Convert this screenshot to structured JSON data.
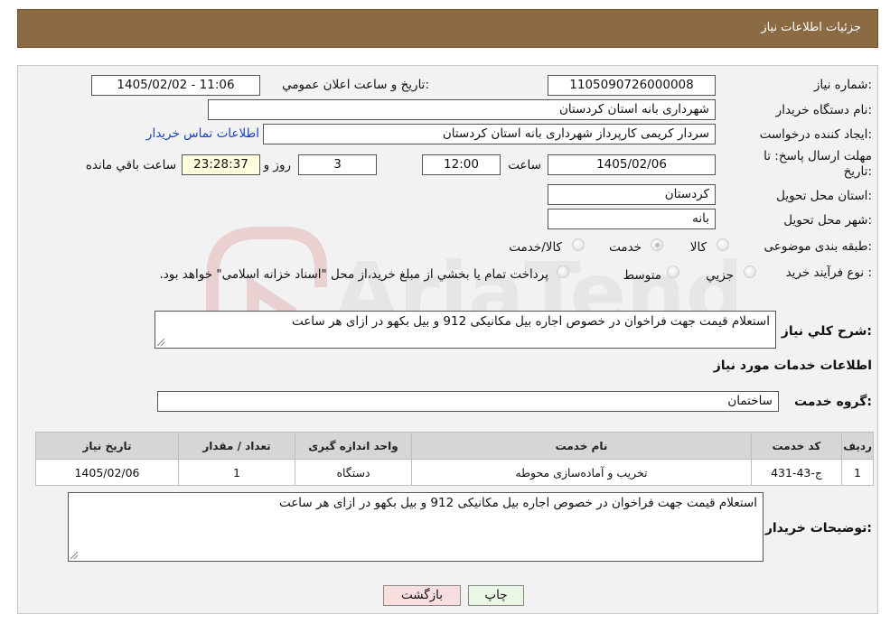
{
  "header": {
    "title": "جزئیات اطلاعات نیاز"
  },
  "labels": {
    "need_number": "شماره نیاز:",
    "announce_datetime": "تاریخ و ساعت اعلان عمومي:",
    "buyer_org": "نام دستگاه خريدار:",
    "requester": "ايجاد کننده درخواست:",
    "deadline_line1": "مهلت ارسال پاسخ: تا",
    "deadline_line2": "تاريخ:",
    "time_word": "ساعت",
    "days_word": "روز و",
    "remaining": "ساعت باقي مانده",
    "province": "استان محل تحويل:",
    "city": "شهر محل تحويل:",
    "category": "طبقه بندی موضوعی:",
    "purchase_type": "نوع فرآيند خريد :",
    "description": "شرح کلي نياز:",
    "services_info": "اطلاعات خدمات مورد نياز",
    "service_group": "گروه خدمت:",
    "buyer_notes": "توضيحات خريدار:"
  },
  "values": {
    "need_number": "1105090726000008",
    "announce_datetime": "1405/02/02 - 11:06",
    "buyer_org": "شهرداری بانه استان کردستان",
    "requester": "سردار کریمی کارپرداز شهرداری بانه استان کردستان",
    "contact_link": "اطلاعات تماس خريدار",
    "deadline_date": "1405/02/06",
    "deadline_time": "12:00",
    "days": "3",
    "remaining_time": "23:28:37",
    "province": "کردستان",
    "city": "بانه",
    "description": "استعلام قیمت جهت فراخوان در خصوص اجاره بیل مکانیکی 912 و بیل بکهو در ازای هر ساعت",
    "service_group": "ساختمان",
    "buyer_notes": "استعلام قیمت جهت فراخوان در خصوص اجاره بیل مکانیکی 912 و بیل بکهو در ازای هر ساعت"
  },
  "category_options": [
    {
      "label": "کالا",
      "selected": false
    },
    {
      "label": "خدمت",
      "selected": true
    },
    {
      "label": "کالا/خدمت",
      "selected": false
    }
  ],
  "purchase_options": [
    {
      "label": "جزيي",
      "selected": false
    },
    {
      "label": "متوسط",
      "selected": false
    }
  ],
  "purchase_note": "پرداخت تمام يا بخشي از مبلغ خريد،از محل \"اسناد خزانه اسلامی\" خواهد بود.",
  "table": {
    "headers": [
      "رديف",
      "کد خدمت",
      "نام خدمت",
      "واحد اندازه گيری",
      "تعداد / مقدار",
      "تاريخ نياز"
    ],
    "rows": [
      [
        "1",
        "ج-43-431",
        "تخریب و آماده‌سازی محوطه",
        "دستگاه",
        "1",
        "1405/02/06"
      ]
    ]
  },
  "buttons": {
    "print": "چاپ",
    "back": "بازگشت"
  },
  "watermark": "AriaTender.neT"
}
